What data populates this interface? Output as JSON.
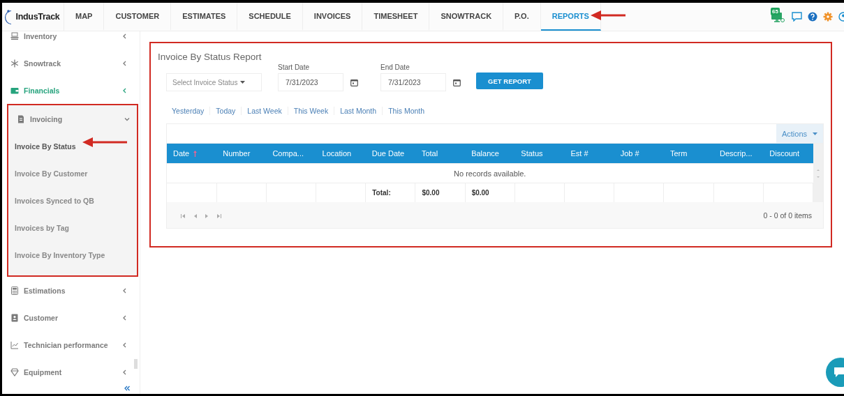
{
  "logo": "IndusTrack",
  "tabs": [
    {
      "label": "MAP",
      "selected": false
    },
    {
      "label": "CUSTOMER",
      "selected": false
    },
    {
      "label": "ESTIMATES",
      "selected": false
    },
    {
      "label": "SCHEDULE",
      "selected": false
    },
    {
      "label": "INVOICES",
      "selected": false
    },
    {
      "label": "TIMESHEET",
      "selected": false
    },
    {
      "label": "SNOWTRACK",
      "selected": false
    },
    {
      "label": "P.O.",
      "selected": false
    },
    {
      "label": "REPORTS",
      "selected": true
    }
  ],
  "notifications": {
    "count": "65"
  },
  "sidebar": {
    "items": [
      {
        "label": "Inventory",
        "selected": false,
        "expanded": false
      },
      {
        "label": "Snowtrack",
        "selected": false,
        "expanded": false
      },
      {
        "label": "Financials",
        "selected": true,
        "expanded": false
      },
      {
        "label": "Invoicing",
        "selected": false,
        "expanded": true,
        "children": [
          {
            "label": "Invoice By Status",
            "selected": true
          },
          {
            "label": "Invoice By Customer",
            "selected": false
          },
          {
            "label": "Invoices Synced to QB",
            "selected": false
          },
          {
            "label": "Invoices by Tag",
            "selected": false
          },
          {
            "label": "Invoice By Inventory Type",
            "selected": false
          }
        ]
      },
      {
        "label": "Estimations",
        "selected": false,
        "expanded": false
      },
      {
        "label": "Customer",
        "selected": false,
        "expanded": false
      },
      {
        "label": "Technician performance",
        "selected": false,
        "expanded": false
      },
      {
        "label": "Equipment",
        "selected": false,
        "expanded": false
      }
    ]
  },
  "report": {
    "title": "Invoice By Status Report",
    "status_select": {
      "placeholder": "Select Invoice Status"
    },
    "start_date": {
      "label": "Start Date",
      "value": "7/31/2023"
    },
    "end_date": {
      "label": "End Date",
      "value": "7/31/2023"
    },
    "button": "GET REPORT",
    "quick_ranges": [
      "Yesterday",
      "Today",
      "Last Week",
      "This Week",
      "Last Month",
      "This Month"
    ],
    "actions": "Actions",
    "table": {
      "columns": [
        {
          "label": "Date",
          "sorted": true
        },
        {
          "label": "Number",
          "sorted": false
        },
        {
          "label": "Compa...",
          "sorted": false
        },
        {
          "label": "Location",
          "sorted": false
        },
        {
          "label": "Due Date",
          "sorted": false,
          "footer": "Total:"
        },
        {
          "label": "Total",
          "sorted": false,
          "footer": "$0.00"
        },
        {
          "label": "Balance",
          "sorted": false,
          "footer": "$0.00"
        },
        {
          "label": "Status",
          "sorted": false
        },
        {
          "label": "Est #",
          "sorted": false
        },
        {
          "label": "Job #",
          "sorted": false
        },
        {
          "label": "Term",
          "sorted": false
        },
        {
          "label": "Descrip...",
          "sorted": false
        },
        {
          "label": "Discount",
          "sorted": false
        }
      ],
      "empty_message": "No records available."
    },
    "pager_info": "0 - 0 of 0 items"
  }
}
